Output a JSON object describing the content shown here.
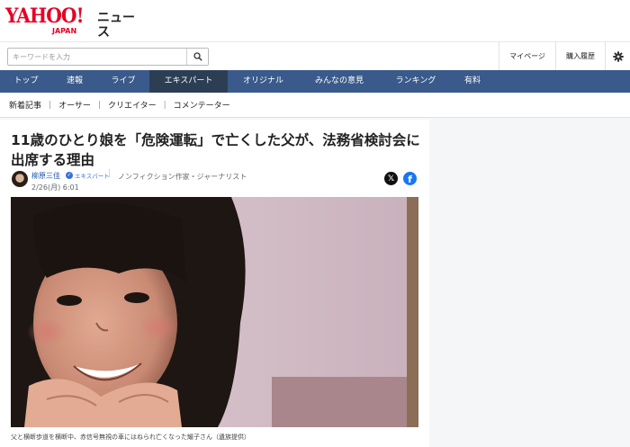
{
  "header": {
    "logo_main": "YAHOO!",
    "logo_sub": "JAPAN",
    "logo_section": "ニュース"
  },
  "search": {
    "placeholder": "キーワードを入力",
    "button_icon": "search-icon"
  },
  "user_links": [
    "マイページ",
    "購入履歴"
  ],
  "settings_icon": "gear-icon",
  "global_nav": [
    {
      "label": "トップ",
      "active": false
    },
    {
      "label": "速報",
      "active": false
    },
    {
      "label": "ライブ",
      "active": false
    },
    {
      "label": "エキスパート",
      "active": true
    },
    {
      "label": "オリジナル",
      "active": false
    },
    {
      "label": "みんなの意見",
      "active": false
    },
    {
      "label": "ランキング",
      "active": false
    },
    {
      "label": "有料",
      "active": false
    }
  ],
  "sub_nav": [
    "新着記事",
    "オーサー",
    "クリエイター",
    "コメンテーター"
  ],
  "article": {
    "title": "11歳のひとり娘を「危険運転」で亡くした父が、法務省検討会に出席する理由",
    "author": "柳原三佳",
    "badge": "エキスパート",
    "author_role": "ノンフィクション作家・ジャーナリスト",
    "date": "2/26(月) 6:01",
    "share": [
      "x-icon",
      "facebook-icon"
    ],
    "caption": "父と横断歩道を横断中、赤信号無視の車にはねられ亡くなった耀子さん（遺族提供）"
  },
  "colors": {
    "brand": "#e60024",
    "nav_bg": "#395a8a",
    "nav_active": "#2c3e54",
    "link": "#1a55a8"
  }
}
